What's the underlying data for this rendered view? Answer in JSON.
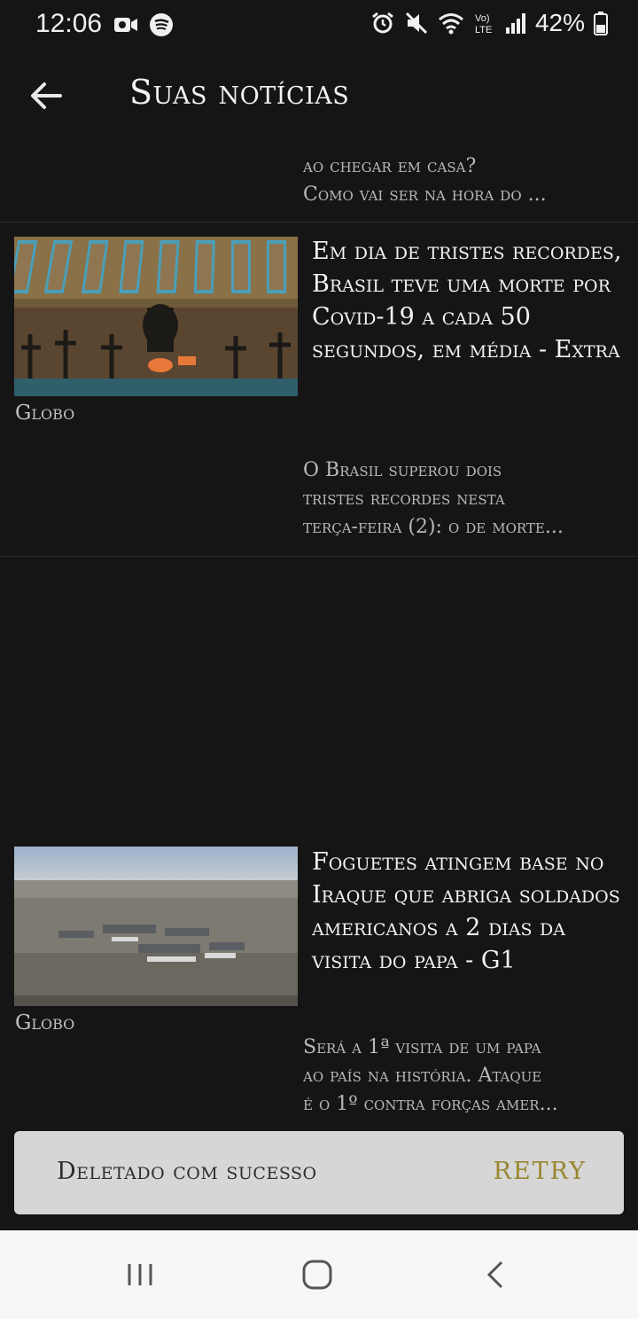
{
  "status_bar": {
    "time": "12:06",
    "battery": "42%",
    "icons": [
      "video-camera-icon",
      "spotify-icon",
      "alarm-icon",
      "mute-icon",
      "wifi-icon",
      "volte-icon",
      "signal-icon",
      "battery-icon"
    ]
  },
  "app_bar": {
    "title": "Suas notícias",
    "back_icon": "arrow-left-icon"
  },
  "news": {
    "previous_item": {
      "snippet_line1": "ao chegar em casa?",
      "snippet_line2": "Como vai ser na hora do ..."
    },
    "items": [
      {
        "image": "cemetery-graves-photo",
        "source": "Globo",
        "title": "Em dia de tristes recordes, Brasil teve uma morte por Covid-19 a cada 50 segundos, em média - Extra",
        "desc_line1": "O Brasil superou dois",
        "desc_line2": "tristes recordes nesta",
        "desc_line3": "terça-feira (2): o de morte..."
      },
      {
        "image": "iraq-base-aerial-photo",
        "source": "Globo",
        "title": "Foguetes atingem base no Iraque que abriga soldados americanos a 2 dias da visita do papa - G1",
        "desc_line1": "Será a 1ª visita de um papa",
        "desc_line2": "ao país na história. Ataque",
        "desc_line3": "é o 1º contra forças amer..."
      }
    ]
  },
  "snackbar": {
    "message": "Deletado com sucesso",
    "action": "RETRY"
  },
  "nav": {
    "recents": "recent-apps-icon",
    "home": "home-icon",
    "back": "back-icon"
  },
  "colors": {
    "background": "#151515",
    "snackbar_bg": "#d6d6d6",
    "snackbar_action": "#9a8630"
  }
}
